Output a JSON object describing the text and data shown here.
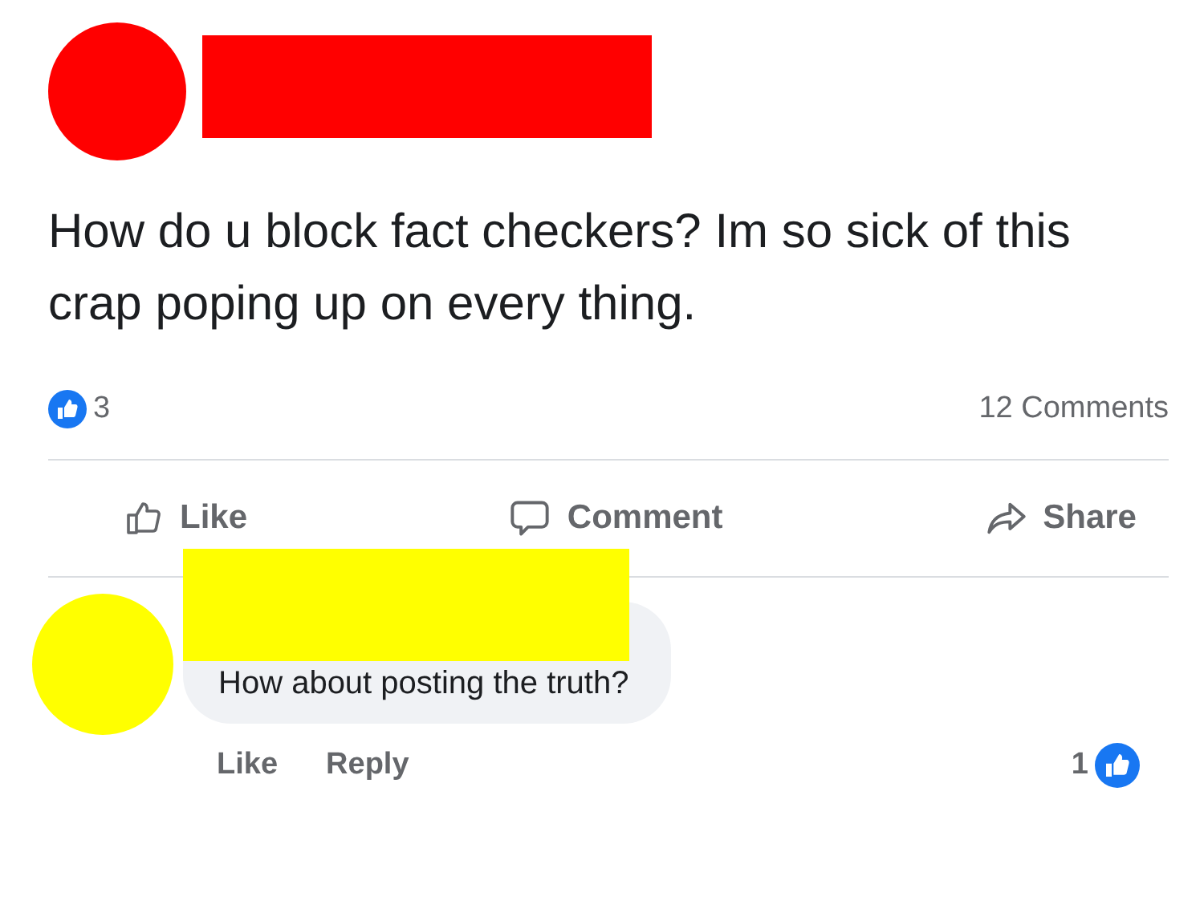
{
  "post": {
    "author": {
      "redacted": true,
      "color": "#ff0000"
    },
    "text": "How do u block fact checkers? Im so sick of this crap poping up on every thing.",
    "reactions": "3",
    "comments_count": "12 Comments",
    "actions": [
      {
        "kind": "like",
        "label": "Like"
      },
      {
        "kind": "comment",
        "label": "Comment"
      },
      {
        "kind": "share",
        "label": "Share"
      }
    ]
  },
  "comment": {
    "author": {
      "redacted": true,
      "color": "#ffff00"
    },
    "text": "How about posting the truth?",
    "actions": [
      "Like",
      "Reply"
    ],
    "reactions": "1"
  }
}
